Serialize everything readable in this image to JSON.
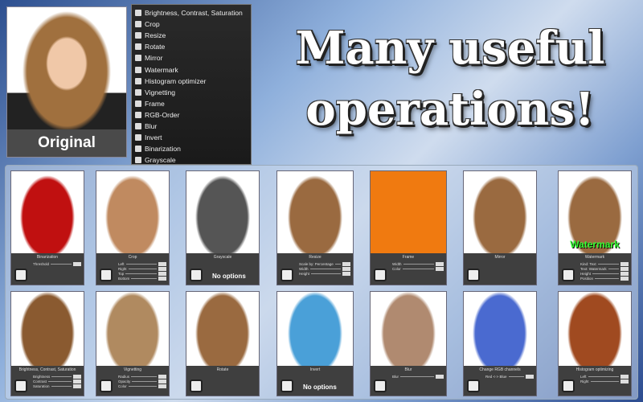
{
  "original": {
    "label": "Original"
  },
  "menu": {
    "items": [
      "Brightness, Contrast, Saturation",
      "Crop",
      "Resize",
      "Rotate",
      "Mirror",
      "Watermark",
      "Histogram optimizer",
      "Vignetting",
      "Frame",
      "RGB-Order",
      "Blur",
      "Invert",
      "Binarization",
      "Grayscale"
    ]
  },
  "headline": {
    "line1": "Many useful",
    "line2": "operations!"
  },
  "cards": [
    {
      "title": "Binarization",
      "controls": [
        "Threshold"
      ],
      "no_options": null,
      "tint": "#c01010"
    },
    {
      "title": "Crop",
      "controls": [
        "Left",
        "Right",
        "Top",
        "Bottom"
      ],
      "no_options": null,
      "tint": "#c08a60"
    },
    {
      "title": "Grayscale",
      "controls": [],
      "no_options": "No options",
      "tint": "#555555"
    },
    {
      "title": "Resize",
      "controls": [
        "Scale by: Percentage",
        "Width",
        "Height"
      ],
      "no_options": null,
      "tint": "#9a6a40"
    },
    {
      "title": "Frame",
      "controls": [
        "Width",
        "Color"
      ],
      "no_options": null,
      "tint": "#f07a10"
    },
    {
      "title": "Mirror",
      "controls": [],
      "no_options": null,
      "tint": "#9a6a40"
    },
    {
      "title": "Watermark",
      "controls": [
        "Kind: Text",
        "Text: Watermark",
        "Height",
        "Position"
      ],
      "no_options": null,
      "tint": "#9a6a40",
      "overlay": "Watermark"
    },
    {
      "title": "Brightness, Contrast, Saturation",
      "controls": [
        "Brightness",
        "Contrast",
        "Saturation"
      ],
      "no_options": null,
      "tint": "#8a5a30"
    },
    {
      "title": "Vignetting",
      "controls": [
        "Radius",
        "Opacity",
        "Color"
      ],
      "no_options": null,
      "tint": "#b08a60"
    },
    {
      "title": "Rotate",
      "controls": [],
      "no_options": null,
      "tint": "#9a6a40"
    },
    {
      "title": "Invert",
      "controls": [],
      "no_options": "No options",
      "tint": "#4aa0d8"
    },
    {
      "title": "Blur",
      "controls": [
        "Blur"
      ],
      "no_options": null,
      "tint": "#b08a70"
    },
    {
      "title": "Change RGB channels",
      "controls": [
        "Red <-> Blue"
      ],
      "no_options": null,
      "tint": "#4a6ad0"
    },
    {
      "title": "Histogram optimizing",
      "controls": [
        "Left",
        "Right"
      ],
      "no_options": null,
      "tint": "#a04a20"
    }
  ]
}
